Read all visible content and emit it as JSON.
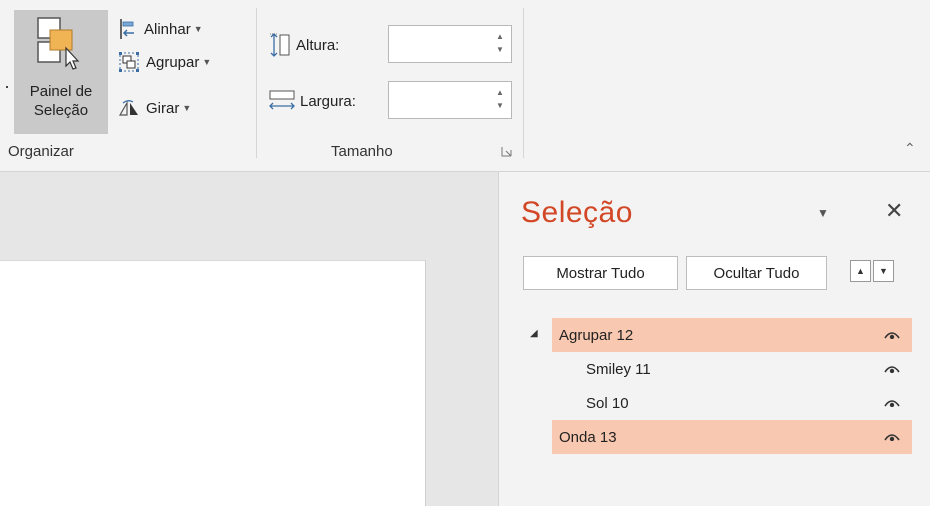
{
  "ribbon": {
    "arrange": {
      "selection_pane_label_1": "Painel de",
      "selection_pane_label_2": "Seleção",
      "align_label": "Alinhar",
      "group_label": "Agrupar",
      "rotate_label": "Girar",
      "group_name": "Organizar"
    },
    "size": {
      "height_label": "Altura:",
      "width_label": "Largura:",
      "height_value": "",
      "width_value": "",
      "group_name": "Tamanho"
    }
  },
  "selection_pane": {
    "title": "Seleção",
    "show_all": "Mostrar Tudo",
    "hide_all": "Ocultar Tudo",
    "items": [
      {
        "label": "Agrupar 12",
        "level": 0,
        "selected": true,
        "expanded": true
      },
      {
        "label": "Smiley 11",
        "level": 1,
        "selected": false
      },
      {
        "label": "Sol 10",
        "level": 1,
        "selected": false
      },
      {
        "label": "Onda 13",
        "level": 0,
        "selected": true
      }
    ]
  },
  "colors": {
    "accent": "#d24726",
    "selected_row": "#f8c8b0"
  },
  "icons": [
    "selection-pane-icon",
    "align-icon",
    "group-icon",
    "rotate-icon",
    "height-icon",
    "width-icon",
    "dropdown-icon",
    "close-icon",
    "move-up-icon",
    "move-down-icon",
    "eye-icon",
    "expand-icon",
    "dialog-launcher-icon",
    "collapse-ribbon-icon"
  ]
}
